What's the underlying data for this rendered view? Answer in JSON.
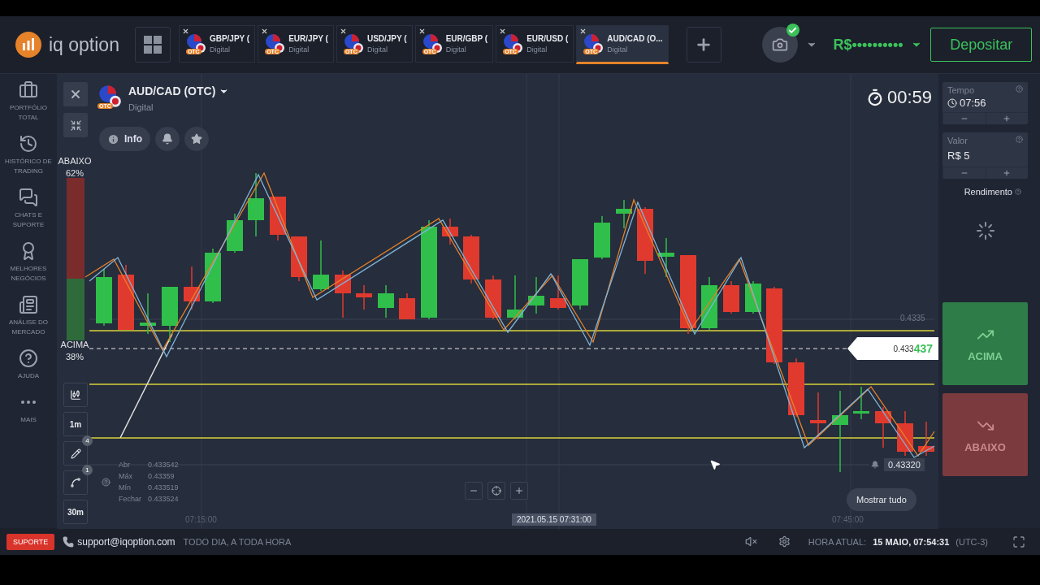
{
  "header": {
    "logo": "iq option",
    "tabs": [
      {
        "pair": "GBP/JPY (",
        "type": "Digital",
        "badge": "OTC",
        "selected": false
      },
      {
        "pair": "EUR/JPY (",
        "type": "Digital",
        "badge": "OTC",
        "selected": false
      },
      {
        "pair": "USD/JPY (",
        "type": "Digital",
        "badge": "OTC",
        "selected": false
      },
      {
        "pair": "EUR/GBP (",
        "type": "Digital",
        "badge": "OTC",
        "selected": false
      },
      {
        "pair": "EUR/USD (",
        "type": "Digital",
        "badge": "OTC",
        "selected": false
      },
      {
        "pair": "AUD/CAD (O...",
        "type": "Digital",
        "badge": "OTC",
        "selected": true
      }
    ],
    "balance": "R$••••••••••",
    "deposit": "Depositar"
  },
  "sidebar": {
    "items": [
      "PORTFÓLIO TOTAL",
      "HISTÓRICO DE TRADING",
      "CHATS E SUPORTE",
      "MELHORES NEGÓCIOS",
      "ANÁLISE DO MERCADO",
      "AJUDA",
      "MAIS"
    ]
  },
  "chart": {
    "instrument": "AUD/CAD (OTC)",
    "type": "Digital",
    "badge": "OTC",
    "info": "Info",
    "timer": "00:59",
    "sentiment": {
      "down_label": "ABAIXO",
      "down_pct": "62%",
      "up_label": "ACIMA",
      "up_pct": "38%",
      "level": 0.62
    },
    "tools": [
      {
        "kind": "icon"
      },
      {
        "kind": "text",
        "label": "1m"
      },
      {
        "kind": "pencil",
        "count": "4"
      },
      {
        "kind": "wave",
        "count": "1"
      },
      {
        "kind": "text",
        "label": "30m"
      }
    ],
    "ohlc": [
      {
        "label": "Abr",
        "value": "0.433542"
      },
      {
        "label": "Máx",
        "value": "0.43359"
      },
      {
        "label": "Mín",
        "value": "0.433519"
      },
      {
        "label": "Fechar",
        "value": "0.433524"
      }
    ],
    "level_price": "0.4335",
    "current_price": {
      "base": "0.433",
      "tail": "437"
    },
    "alert_price": "0.43320",
    "time_labels": [
      {
        "text": "07:15:00",
        "selected": false
      },
      {
        "text": "2021.05.15 07:31:00",
        "selected": true
      },
      {
        "text": "07:45:00",
        "selected": false
      }
    ],
    "show_all": "Mostrar tudo"
  },
  "trade_panel": {
    "time": {
      "label": "Tempo",
      "value": "07:56"
    },
    "amount": {
      "label": "Valor",
      "value": "R$ 5"
    },
    "yield_label": "Rendimento",
    "up": "ACIMA",
    "down": "ABAIXO"
  },
  "footer": {
    "support": "SUPORTE",
    "email": "support@iqoption.com",
    "hours": "TODO DIA, A TODA HORA",
    "time_label": "HORA ATUAL:",
    "time": "15 MAIO, 07:54:31",
    "zone": "(UTC-3)"
  }
}
